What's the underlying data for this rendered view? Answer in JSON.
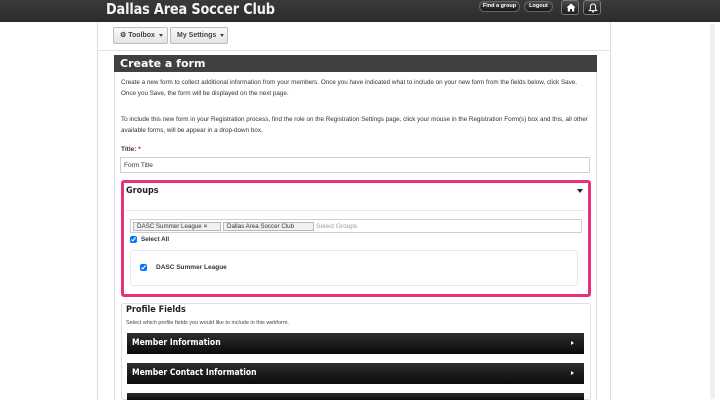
{
  "header": {
    "site_title": "Dallas Area Soccer Club",
    "find_group_label": "Find a group",
    "logout_label": "Logout",
    "icons": [
      "home-icon",
      "bell-icon"
    ]
  },
  "toolbar": {
    "toolbox_label": "Toolbox",
    "settings_label": "My Settings",
    "icons": [
      "gear-icon",
      "caret-down-icon"
    ]
  },
  "panel": {
    "title": "Create a form",
    "intro": "Create a new form to collect additional information from your members. Once you have indicated what to include on your new form from the fields below, click Save. Once you Save, the form will be displayed on the next page.",
    "instructions": "To include this new form in your Registration process, find the role on the Registration Settings page, click your mouse in the Registration Form(s) box and this, all other available forms, will be appear in a drop-down box."
  },
  "form": {
    "title_label": "Title:",
    "required_mark": "*",
    "title_value": "Form Title"
  },
  "groups": {
    "heading": "Groups",
    "selected": [
      "DASC Summer League",
      "Dallas Area Soccer Club"
    ],
    "remove_mark": "×",
    "placeholder": "Select Groups",
    "select_all_label": "Select All",
    "select_all_checked": true,
    "options": [
      {
        "label": "DASC Summer League",
        "checked": true
      }
    ],
    "highlight_color": "#e8317a"
  },
  "profile_fields": {
    "heading": "Profile Fields",
    "description": "Select which profile fields you would like to include in this webform.",
    "sections": [
      "Member Information",
      "Member Contact Information"
    ]
  }
}
